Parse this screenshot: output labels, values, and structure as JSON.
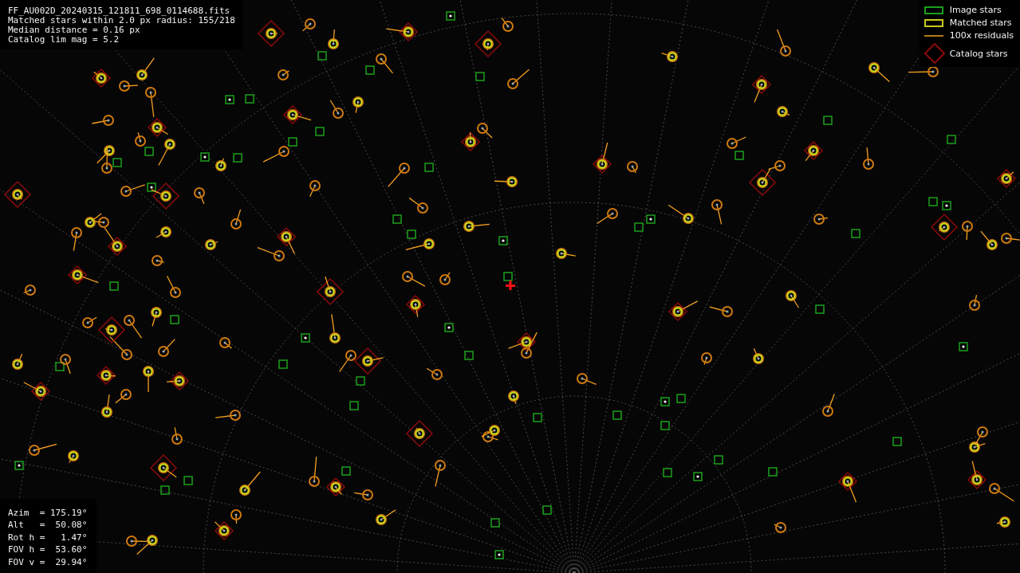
{
  "info": {
    "lines": [
      "FF_AU002D_20240315_121811_698_0114688.fits",
      "Matched stars within 2.0 px radius: 155/218",
      "Median distance = 0.16 px",
      "Catalog lim mag = 5.2"
    ]
  },
  "legend": [
    {
      "kind": "image",
      "label": "Image stars"
    },
    {
      "kind": "matched",
      "label": "Matched stars"
    },
    {
      "kind": "residual",
      "label": "100x residuals"
    },
    {
      "kind": "catalog",
      "label": "Catalog stars"
    }
  ],
  "pointing": {
    "lines": [
      "Azim  = 175.19°",
      "Alt   =  50.08°",
      "Rot h =   1.47°",
      "FOV h =  53.60°",
      "FOV v =  29.94°"
    ]
  }
}
